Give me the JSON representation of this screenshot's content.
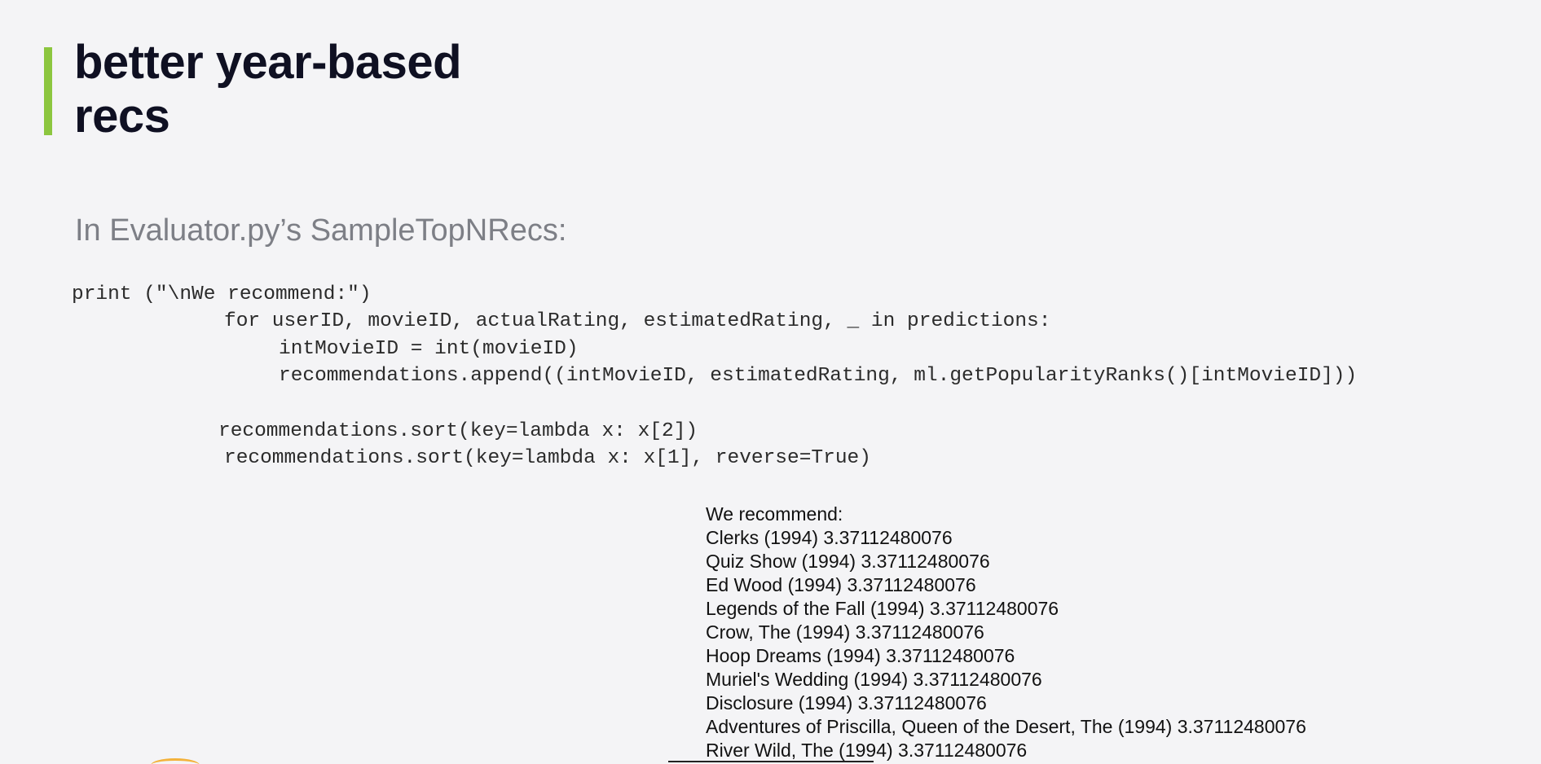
{
  "slide": {
    "title_line1": "better year-based",
    "title_line2": "recs",
    "subtitle": "In Evaluator.py’s SampleTopNRecs:",
    "accent_color": "#8cc63f"
  },
  "code": {
    "lines": [
      "print (\"\\nWe recommend:\")",
      "for userID, movieID, actualRating, estimatedRating, _ in predictions:",
      "intMovieID = int(movieID)",
      "recommendations.append((intMovieID, estimatedRating, ml.getPopularityRanks()[intMovieID]))",
      "recommendations.sort(key=lambda x: x[2])",
      "recommendations.sort(key=lambda x: x[1], reverse=True)"
    ]
  },
  "output": {
    "header": "We recommend:",
    "lines": [
      "Clerks (1994) 3.37112480076",
      "Quiz Show (1994) 3.37112480076",
      "Ed Wood (1994) 3.37112480076",
      "Legends of the Fall (1994) 3.37112480076",
      "Crow, The (1994) 3.37112480076",
      "Hoop Dreams (1994) 3.37112480076",
      "Muriel's Wedding (1994) 3.37112480076",
      "Disclosure (1994) 3.37112480076",
      "Adventures of Priscilla, Queen of the Desert, The (1994) 3.37112480076",
      "River Wild, The (1994) 3.37112480076"
    ]
  }
}
